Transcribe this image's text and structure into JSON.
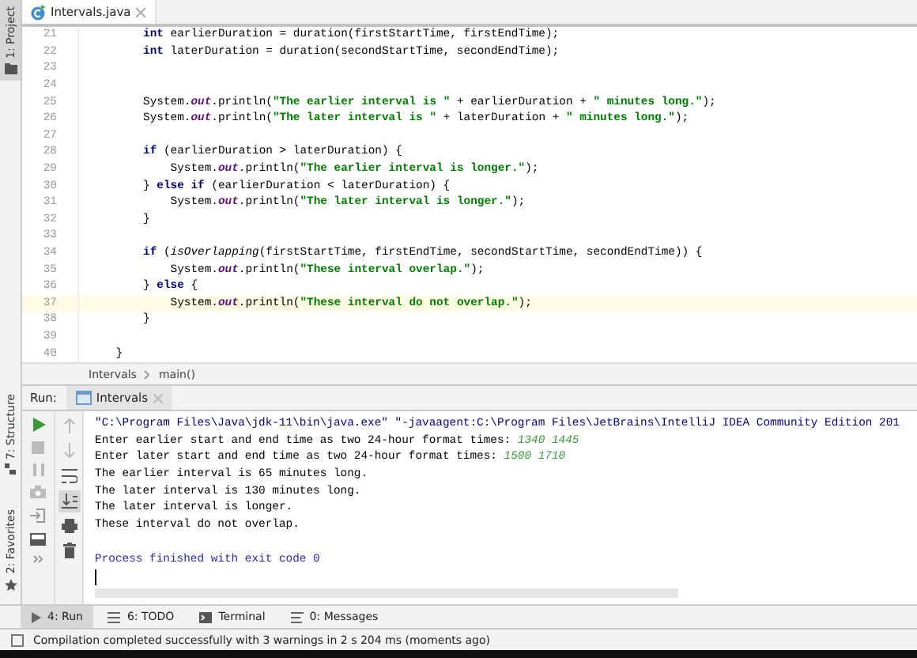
{
  "side_tabs_top": [
    {
      "label": "1: Project",
      "selected": true
    }
  ],
  "side_tabs_bottom": [
    {
      "label": "7: Structure",
      "selected": false
    },
    {
      "label": "2: Favorites",
      "selected": false
    }
  ],
  "editor_tab": {
    "label": "Intervals.java",
    "selected": true
  },
  "code_lines": [
    {
      "number": "21",
      "highlighted": false,
      "segments": [
        {
          "kind": "kw",
          "text": "        int"
        },
        {
          "kind": "plain",
          "text": " earlierDuration = duration(firstStartTime, firstEndTime);"
        }
      ]
    },
    {
      "number": "22",
      "highlighted": false,
      "segments": [
        {
          "kind": "kw",
          "text": "        int"
        },
        {
          "kind": "plain",
          "text": " laterDuration = duration(secondStartTime, secondEndTime);"
        }
      ]
    },
    {
      "number": "23",
      "highlighted": false
    },
    {
      "number": "24",
      "highlighted": false
    },
    {
      "number": "25",
      "highlighted": false,
      "segments": [
        {
          "kind": "plain",
          "text": "        System."
        },
        {
          "kind": "field",
          "text": "out"
        },
        {
          "kind": "plain",
          "text": ".println("
        },
        {
          "kind": "str",
          "text": "\"The earlier interval is \""
        },
        {
          "kind": "plain",
          "text": " + earlierDuration + "
        },
        {
          "kind": "str",
          "text": "\" minutes long.\""
        },
        {
          "kind": "plain",
          "text": ");"
        }
      ]
    },
    {
      "number": "26",
      "highlighted": false,
      "segments": [
        {
          "kind": "plain",
          "text": "        System."
        },
        {
          "kind": "field",
          "text": "out"
        },
        {
          "kind": "plain",
          "text": ".println("
        },
        {
          "kind": "str",
          "text": "\"The later interval is \""
        },
        {
          "kind": "plain",
          "text": " + laterDuration + "
        },
        {
          "kind": "str",
          "text": "\" minutes long.\""
        },
        {
          "kind": "plain",
          "text": ");"
        }
      ]
    },
    {
      "number": "27",
      "highlighted": false
    },
    {
      "number": "28",
      "highlighted": false,
      "segments": [
        {
          "kind": "kw",
          "text": "        if"
        },
        {
          "kind": "plain",
          "text": " (earlierDuration > laterDuration) {"
        }
      ]
    },
    {
      "number": "29",
      "highlighted": false,
      "segments": [
        {
          "kind": "plain",
          "text": "            System."
        },
        {
          "kind": "field",
          "text": "out"
        },
        {
          "kind": "plain",
          "text": ".println("
        },
        {
          "kind": "str",
          "text": "\"The earlier interval is longer.\""
        },
        {
          "kind": "plain",
          "text": ");"
        }
      ]
    },
    {
      "number": "30",
      "highlighted": false,
      "segments": [
        {
          "kind": "plain",
          "text": "        } "
        },
        {
          "kind": "kw",
          "text": "else if"
        },
        {
          "kind": "plain",
          "text": " (earlierDuration < laterDuration) {"
        }
      ]
    },
    {
      "number": "31",
      "highlighted": false,
      "segments": [
        {
          "kind": "plain",
          "text": "            System."
        },
        {
          "kind": "field",
          "text": "out"
        },
        {
          "kind": "plain",
          "text": ".println("
        },
        {
          "kind": "str",
          "text": "\"The later interval is longer.\""
        },
        {
          "kind": "plain",
          "text": ");"
        }
      ]
    },
    {
      "number": "32",
      "highlighted": false,
      "segments": [
        {
          "kind": "plain",
          "text": "        }"
        }
      ]
    },
    {
      "number": "33",
      "highlighted": false
    },
    {
      "number": "34",
      "highlighted": false,
      "segments": [
        {
          "kind": "kw",
          "text": "        if"
        },
        {
          "kind": "plain",
          "text": " ("
        },
        {
          "kind": "static",
          "text": "isOverlapping"
        },
        {
          "kind": "plain",
          "text": "(firstStartTime, firstEndTime, secondStartTime, secondEndTime)) {"
        }
      ]
    },
    {
      "number": "35",
      "highlighted": false,
      "segments": [
        {
          "kind": "plain",
          "text": "            System."
        },
        {
          "kind": "field",
          "text": "out"
        },
        {
          "kind": "plain",
          "text": ".println("
        },
        {
          "kind": "str",
          "text": "\"These interval overlap.\""
        },
        {
          "kind": "plain",
          "text": ");"
        }
      ]
    },
    {
      "number": "36",
      "highlighted": false,
      "segments": [
        {
          "kind": "plain",
          "text": "        } "
        },
        {
          "kind": "kw",
          "text": "else"
        },
        {
          "kind": "plain",
          "text": " {"
        }
      ]
    },
    {
      "number": "37",
      "highlighted": true,
      "segments": [
        {
          "kind": "plain",
          "text": "            System."
        },
        {
          "kind": "field",
          "text": "out"
        },
        {
          "kind": "plain",
          "text": ".println("
        },
        {
          "kind": "str",
          "text": "\"These interval do not overlap.\""
        },
        {
          "kind": "plain",
          "text": ");"
        }
      ]
    },
    {
      "number": "38",
      "highlighted": false,
      "segments": [
        {
          "kind": "plain",
          "text": "        }"
        }
      ]
    },
    {
      "number": "39",
      "highlighted": false
    },
    {
      "number": "40",
      "highlighted": false,
      "segments": [
        {
          "kind": "plain",
          "text": "    }"
        }
      ]
    }
  ],
  "breadcrumbs": [
    "Intervals",
    "main()"
  ],
  "run_panel": {
    "label": "Run:",
    "tab": {
      "label": "Intervals",
      "selected": true
    },
    "output": [
      {
        "segments": [
          {
            "kind": "cmd",
            "text": "\"C:\\Program Files\\Java\\jdk-11\\bin\\java.exe\" \"-javaagent:C:\\Program Files\\JetBrains\\IntelliJ IDEA Community Edition 201"
          }
        ]
      },
      {
        "segments": [
          {
            "kind": "plain",
            "text": "Enter earlier start and end time as two 24-hour format times: "
          },
          {
            "kind": "input",
            "text": "1340 1445"
          }
        ]
      },
      {
        "segments": [
          {
            "kind": "plain",
            "text": "Enter later start and end time as two 24-hour format times: "
          },
          {
            "kind": "input",
            "text": "1500 1710"
          }
        ]
      },
      {
        "segments": [
          {
            "kind": "plain",
            "text": "The earlier interval is 65 minutes long."
          }
        ]
      },
      {
        "segments": [
          {
            "kind": "plain",
            "text": "The later interval is 130 minutes long."
          }
        ]
      },
      {
        "segments": [
          {
            "kind": "plain",
            "text": "The later interval is longer."
          }
        ]
      },
      {
        "segments": [
          {
            "kind": "plain",
            "text": "These interval do not overlap."
          }
        ]
      },
      {
        "gap_before": true,
        "segments": [
          {
            "kind": "exit",
            "text": "Process finished with exit code 0"
          }
        ]
      }
    ]
  },
  "bottom_tabs": [
    {
      "label": "4: Run",
      "selected": true
    },
    {
      "label": "6: TODO",
      "selected": false
    },
    {
      "label": "Terminal",
      "selected": false
    },
    {
      "label": "0: Messages",
      "selected": false
    }
  ],
  "status_bar": "Compilation completed successfully with 3 warnings in 2 s 204 ms (moments ago)"
}
